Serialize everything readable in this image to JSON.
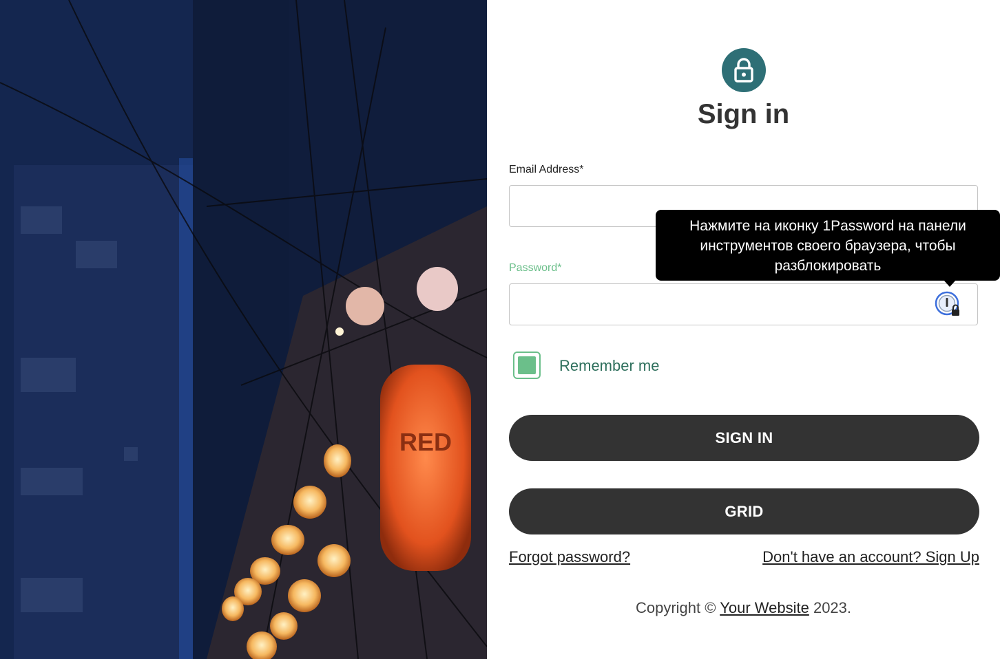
{
  "form": {
    "title": "Sign in",
    "email_label": "Email Address",
    "required_mark": "*",
    "email_value": "",
    "password_label": "Password",
    "password_value": "",
    "remember_label": "Remember me",
    "remember_checked": true,
    "sign_in_button": "SIGN IN",
    "grid_button": "GRID",
    "forgot_link": "Forgot password?",
    "signup_link": "Don't have an account? Sign Up",
    "copyright_prefix": "Copyright ©",
    "copyright_link": "Your Website",
    "copyright_suffix": "2023."
  },
  "tooltip": {
    "text": "Нажмите на иконку 1Password на панели инструментов своего браузера, чтобы разблокировать"
  },
  "photo": {
    "sign_text": "RED"
  },
  "icons": {
    "header": "lock-icon",
    "password_manager": "1password-lock-icon"
  },
  "colors": {
    "accent": "#2e6f76",
    "green": "#6bbf8a",
    "button": "#333333"
  }
}
